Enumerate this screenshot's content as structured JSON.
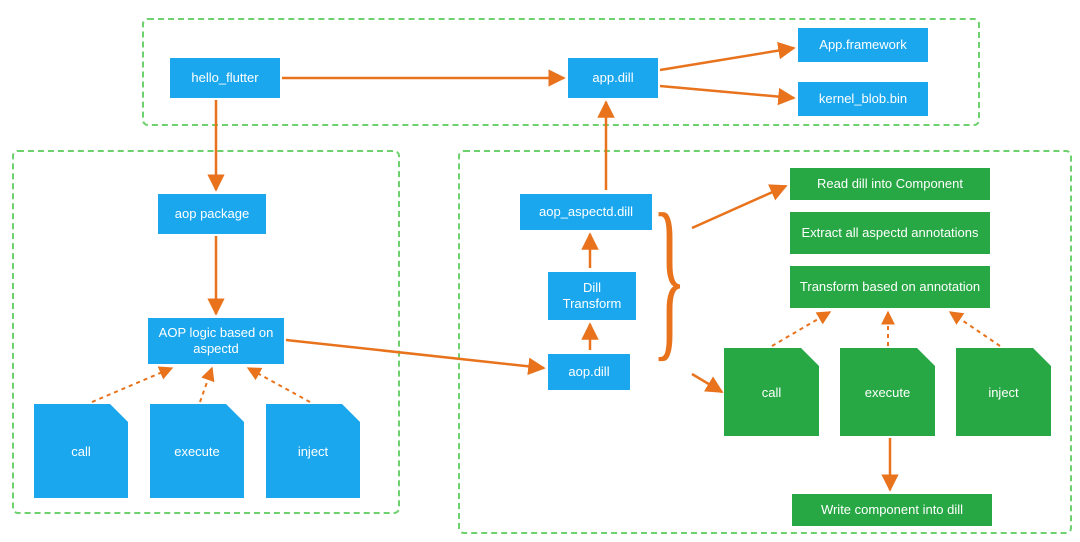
{
  "boxes": {
    "hello_flutter": "hello_flutter",
    "app_dill": "app.dill",
    "app_framework": "App.framework",
    "kernel_blob": "kernel_blob.bin",
    "aop_package": "aop package",
    "aop_logic": "AOP logic based on aspectd",
    "call_l": "call",
    "execute_l": "execute",
    "inject_l": "inject",
    "aop_dill": "aop.dill",
    "dill_transform": "Dill Transform",
    "aop_aspectd_dill": "aop_aspectd.dill",
    "read_dill": "Read dill into Component",
    "extract_ann": "Extract all aspectd annotations",
    "transform_ann": "Transform based on annotation",
    "call_r": "call",
    "execute_r": "execute",
    "inject_r": "inject",
    "write_comp": "Write component into dill"
  }
}
